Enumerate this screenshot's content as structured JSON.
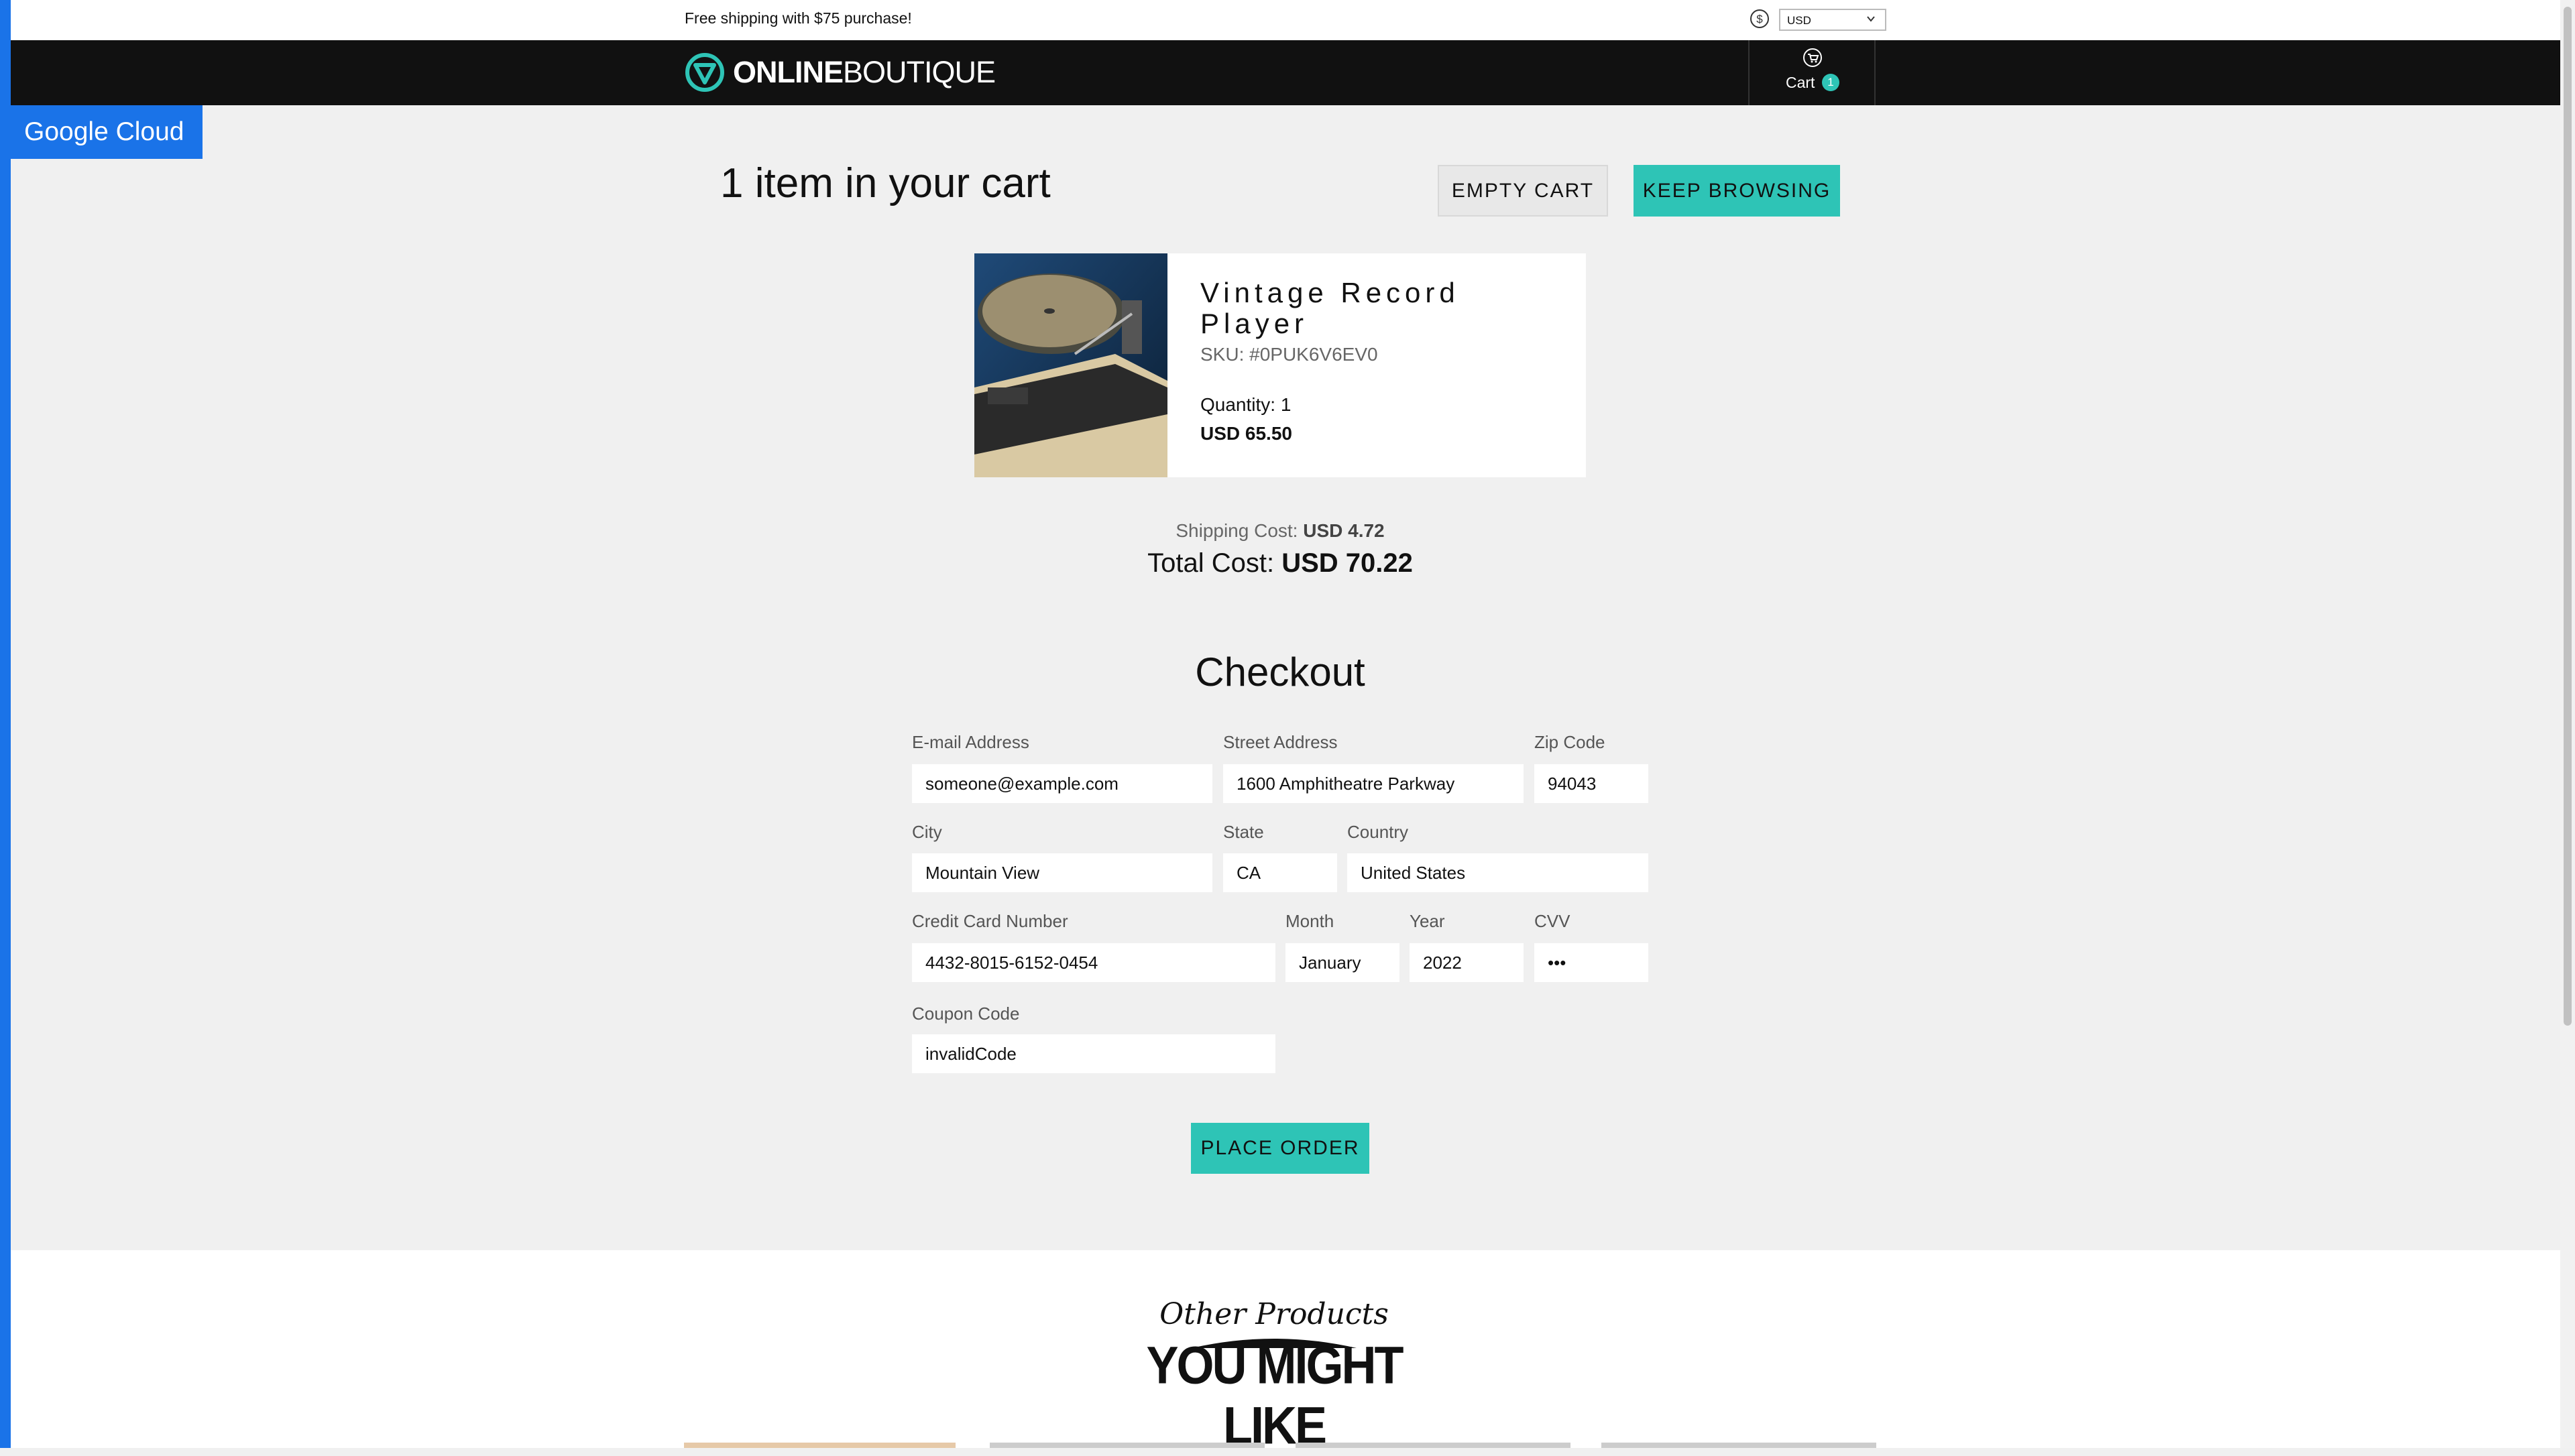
{
  "topbar": {
    "promo": "Free shipping with $75 purchase!",
    "currency": "USD"
  },
  "navbar": {
    "logo_bold": "ONLINE",
    "logo_thin": "BOUTIQUE",
    "cart_label": "Cart",
    "cart_count": "1"
  },
  "gcloud_label": "Google Cloud",
  "cart": {
    "title": "1 item in your cart",
    "empty_label": "EMPTY CART",
    "keep_label": "KEEP BROWSING",
    "item": {
      "name": "Vintage Record Player",
      "sku": "SKU: #0PUK6V6EV0",
      "quantity": "Quantity: 1",
      "price": "USD 65.50"
    },
    "shipping_label": "Shipping Cost:",
    "shipping_value": "USD 4.72",
    "total_label": "Total Cost:",
    "total_value": "USD 70.22"
  },
  "checkout": {
    "title": "Checkout",
    "email": {
      "label": "E-mail Address",
      "value": "someone@example.com"
    },
    "street": {
      "label": "Street Address",
      "value": "1600 Amphitheatre Parkway"
    },
    "zip": {
      "label": "Zip Code",
      "value": "94043"
    },
    "city": {
      "label": "City",
      "value": "Mountain View"
    },
    "state": {
      "label": "State",
      "value": "CA"
    },
    "country": {
      "label": "Country",
      "value": "United States"
    },
    "card": {
      "label": "Credit Card Number",
      "value": "4432-8015-6152-0454"
    },
    "month": {
      "label": "Month",
      "value": "January"
    },
    "year": {
      "label": "Year",
      "value": "2022"
    },
    "cvv": {
      "label": "CVV",
      "value": "•••"
    },
    "coupon": {
      "label": "Coupon Code",
      "value": "invalidCode"
    },
    "place_label": "PLACE ORDER"
  },
  "recommendations": {
    "top": "Other Products",
    "bottom": "YOU MIGHT LIKE"
  },
  "colors": {
    "accent": "#2ec4b6",
    "navbar": "#111111",
    "gcloud": "#1a73e8"
  }
}
